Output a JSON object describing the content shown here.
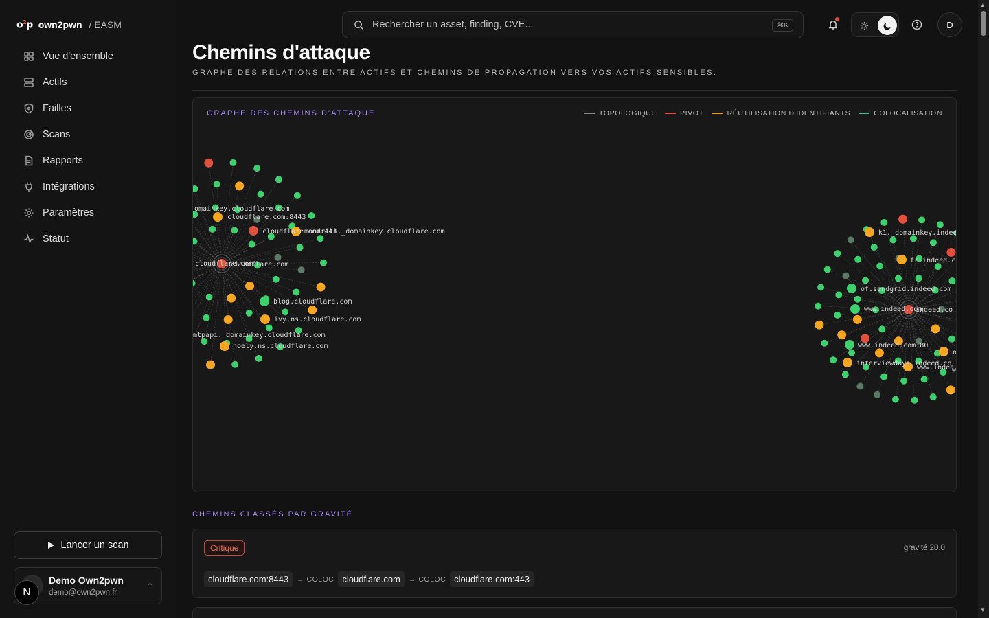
{
  "brand": {
    "logo": "o2p",
    "name": "own2pwn",
    "suffix": "/ EASM"
  },
  "sidebar": {
    "items": [
      {
        "label": "Vue d'ensemble",
        "icon": "grid-icon"
      },
      {
        "label": "Actifs",
        "icon": "server-icon"
      },
      {
        "label": "Failles",
        "icon": "shield-icon"
      },
      {
        "label": "Scans",
        "icon": "radar-icon"
      },
      {
        "label": "Rapports",
        "icon": "document-icon"
      },
      {
        "label": "Intégrations",
        "icon": "plug-icon"
      },
      {
        "label": "Paramètres",
        "icon": "gear-icon"
      },
      {
        "label": "Statut",
        "icon": "activity-icon"
      }
    ],
    "scan_button": "Lancer un scan",
    "user": {
      "name": "Demo Own2pwn",
      "email": "demo@own2pwn.fr",
      "initial": "N"
    }
  },
  "topbar": {
    "search_placeholder": "Rechercher un asset, finding, CVE...",
    "shortcut": "⌘K",
    "profile_initial": "D"
  },
  "page": {
    "title": "Chemins d'attaque",
    "subtitle": "GRAPHE DES RELATIONS ENTRE ACTIFS ET CHEMINS DE PROPAGATION VERS VOS ACTIFS SENSIBLES."
  },
  "graph": {
    "title": "GRAPHE DES CHEMINS D'ATTAQUE",
    "legend": [
      {
        "label": "TOPOLOGIQUE",
        "color": "#8a8a8a"
      },
      {
        "label": "PIVOT",
        "color": "#e0503e"
      },
      {
        "label": "RÉUTILISATION D'IDENTIFIANTS",
        "color": "#e8a030"
      },
      {
        "label": "COLOCALISATION",
        "color": "#4fb893"
      }
    ],
    "colors": {
      "green": "#3ecf6e",
      "orange": "#f5a623",
      "red": "#e0503e",
      "gray": "#5b7a66"
    },
    "labels_left": [
      "omainkey.cloudflare.com",
      "cloudflare.com:8443",
      "cloudflare.com:443",
      "mandrill._domainkey.cloudflare.com",
      "cloudflare.com",
      "cloudflare.com",
      "blog.cloudflare.com",
      "ivy.ns.cloudflare.com",
      "mtpapi._domainkey.cloudflare.com",
      "noely.ns.cloudflare.com"
    ],
    "labels_right": [
      "k1._domainkey.indee",
      "fr.indeed.c",
      "of.sendgrid.indeed.com",
      "www.indeed.com",
      "indeed.co",
      "www.indeed.com:80",
      "interviewdays.indeed.co",
      "www.indee",
      "o",
      "ww"
    ]
  },
  "paths_section": {
    "title": "CHEMINS CLASSÉS PAR GRAVITÉ",
    "paths": [
      {
        "severity": "Critique",
        "gravity": "gravité 20.0",
        "nodes": [
          "cloudflare.com:8443",
          "cloudflare.com",
          "cloudflare.com:443"
        ],
        "relations": [
          "COLOC",
          "COLOC"
        ]
      }
    ]
  }
}
